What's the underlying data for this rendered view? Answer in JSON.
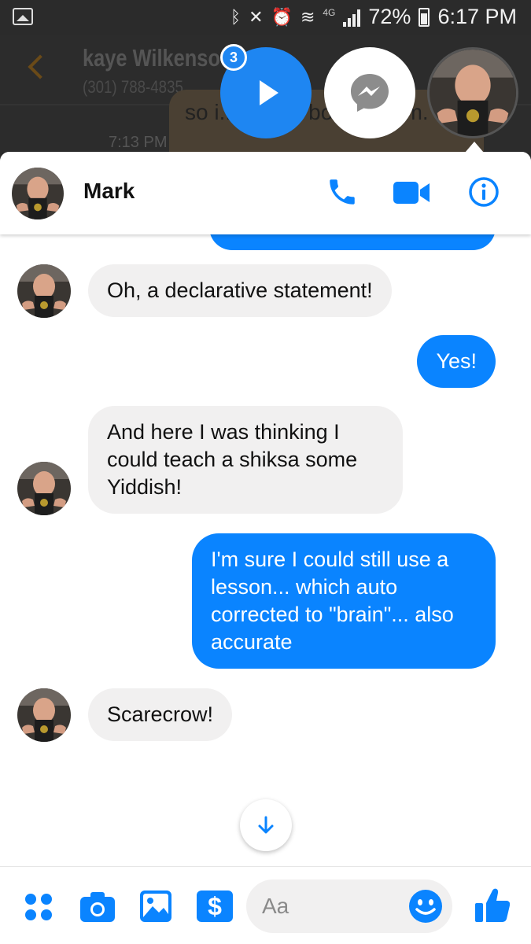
{
  "status_bar": {
    "network_label": "4G",
    "battery_text": "72%",
    "time": "6:17 PM"
  },
  "background_app": {
    "contact_name": "kaye Wilkenso",
    "contact_phone": "(301) 788-4835",
    "message_fragment": "so i... D... th book at him.",
    "message_time": "7:13 PM"
  },
  "chat_heads": {
    "unread_badge": "3"
  },
  "chat": {
    "contact_name": "Mark",
    "messages": [
      {
        "direction": "in",
        "text": "Oh, a declarative statement!"
      },
      {
        "direction": "out",
        "text": "Yes!"
      },
      {
        "direction": "in",
        "text": "And here I was thinking I could teach a shiksa some Yiddish!"
      },
      {
        "direction": "out",
        "text": "I'm sure I could still use a lesson... which auto corrected to \"brain\"... also accurate"
      },
      {
        "direction": "in",
        "text": "Scarecrow!"
      }
    ]
  },
  "composer": {
    "placeholder": "Aa"
  },
  "colors": {
    "accent": "#0a84ff",
    "incoming_bubble": "#f1f0f0"
  }
}
